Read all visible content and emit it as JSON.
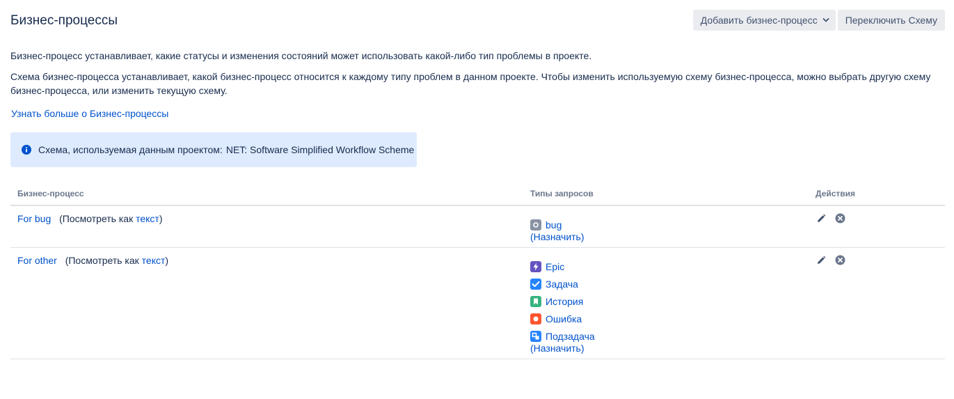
{
  "page": {
    "title": "Бизнес-процессы"
  },
  "toolbar": {
    "add_label": "Добавить бизнес-процесс",
    "switch_label": "Переключить Схему"
  },
  "description": {
    "line1": "Бизнес-процесс устанавливает, какие статусы и изменения состояний может использовать какой-либо тип проблемы в проекте.",
    "line2": "Схема бизнес-процесса устанавливает, какой бизнес-процесс относится к каждому типу проблем в данном проекте. Чтобы изменить используемую схему бизнес-процесса, можно выбрать другую схему бизнес-процесса, или изменить текущую схему."
  },
  "learn_more": "Узнать больше о Бизнес-процессы",
  "info": {
    "label": "Схема, используемая данным проектом:",
    "scheme_name": "NET: Software Simplified Workflow Scheme",
    "color": "#0052cc"
  },
  "table": {
    "headers": {
      "workflow": "Бизнес-процесс",
      "issue_types": "Типы запросов",
      "actions": "Действия"
    },
    "view_as_prefix": "(Посмотреть как ",
    "view_as_link": "текст",
    "view_as_suffix": ")",
    "assign_label": "(Назначить)",
    "rows": [
      {
        "name": "For bug",
        "types": [
          {
            "label": "bug",
            "icon": "bug-icon",
            "color": "#8993a4"
          }
        ]
      },
      {
        "name": "For other",
        "types": [
          {
            "label": "Epic",
            "icon": "epic-icon",
            "color": "#6554c0"
          },
          {
            "label": "Задача",
            "icon": "task-icon",
            "color": "#2684ff"
          },
          {
            "label": "История",
            "icon": "story-icon",
            "color": "#36b37e"
          },
          {
            "label": "Ошибка",
            "icon": "error-icon",
            "color": "#ff5630"
          },
          {
            "label": "Подзадача",
            "icon": "subtask-icon",
            "color": "#2684ff"
          }
        ]
      }
    ]
  },
  "colors": {
    "link": "#0052cc",
    "text": "#172b4d",
    "info_bg": "#deebff",
    "button_bg": "#ebecf0"
  }
}
